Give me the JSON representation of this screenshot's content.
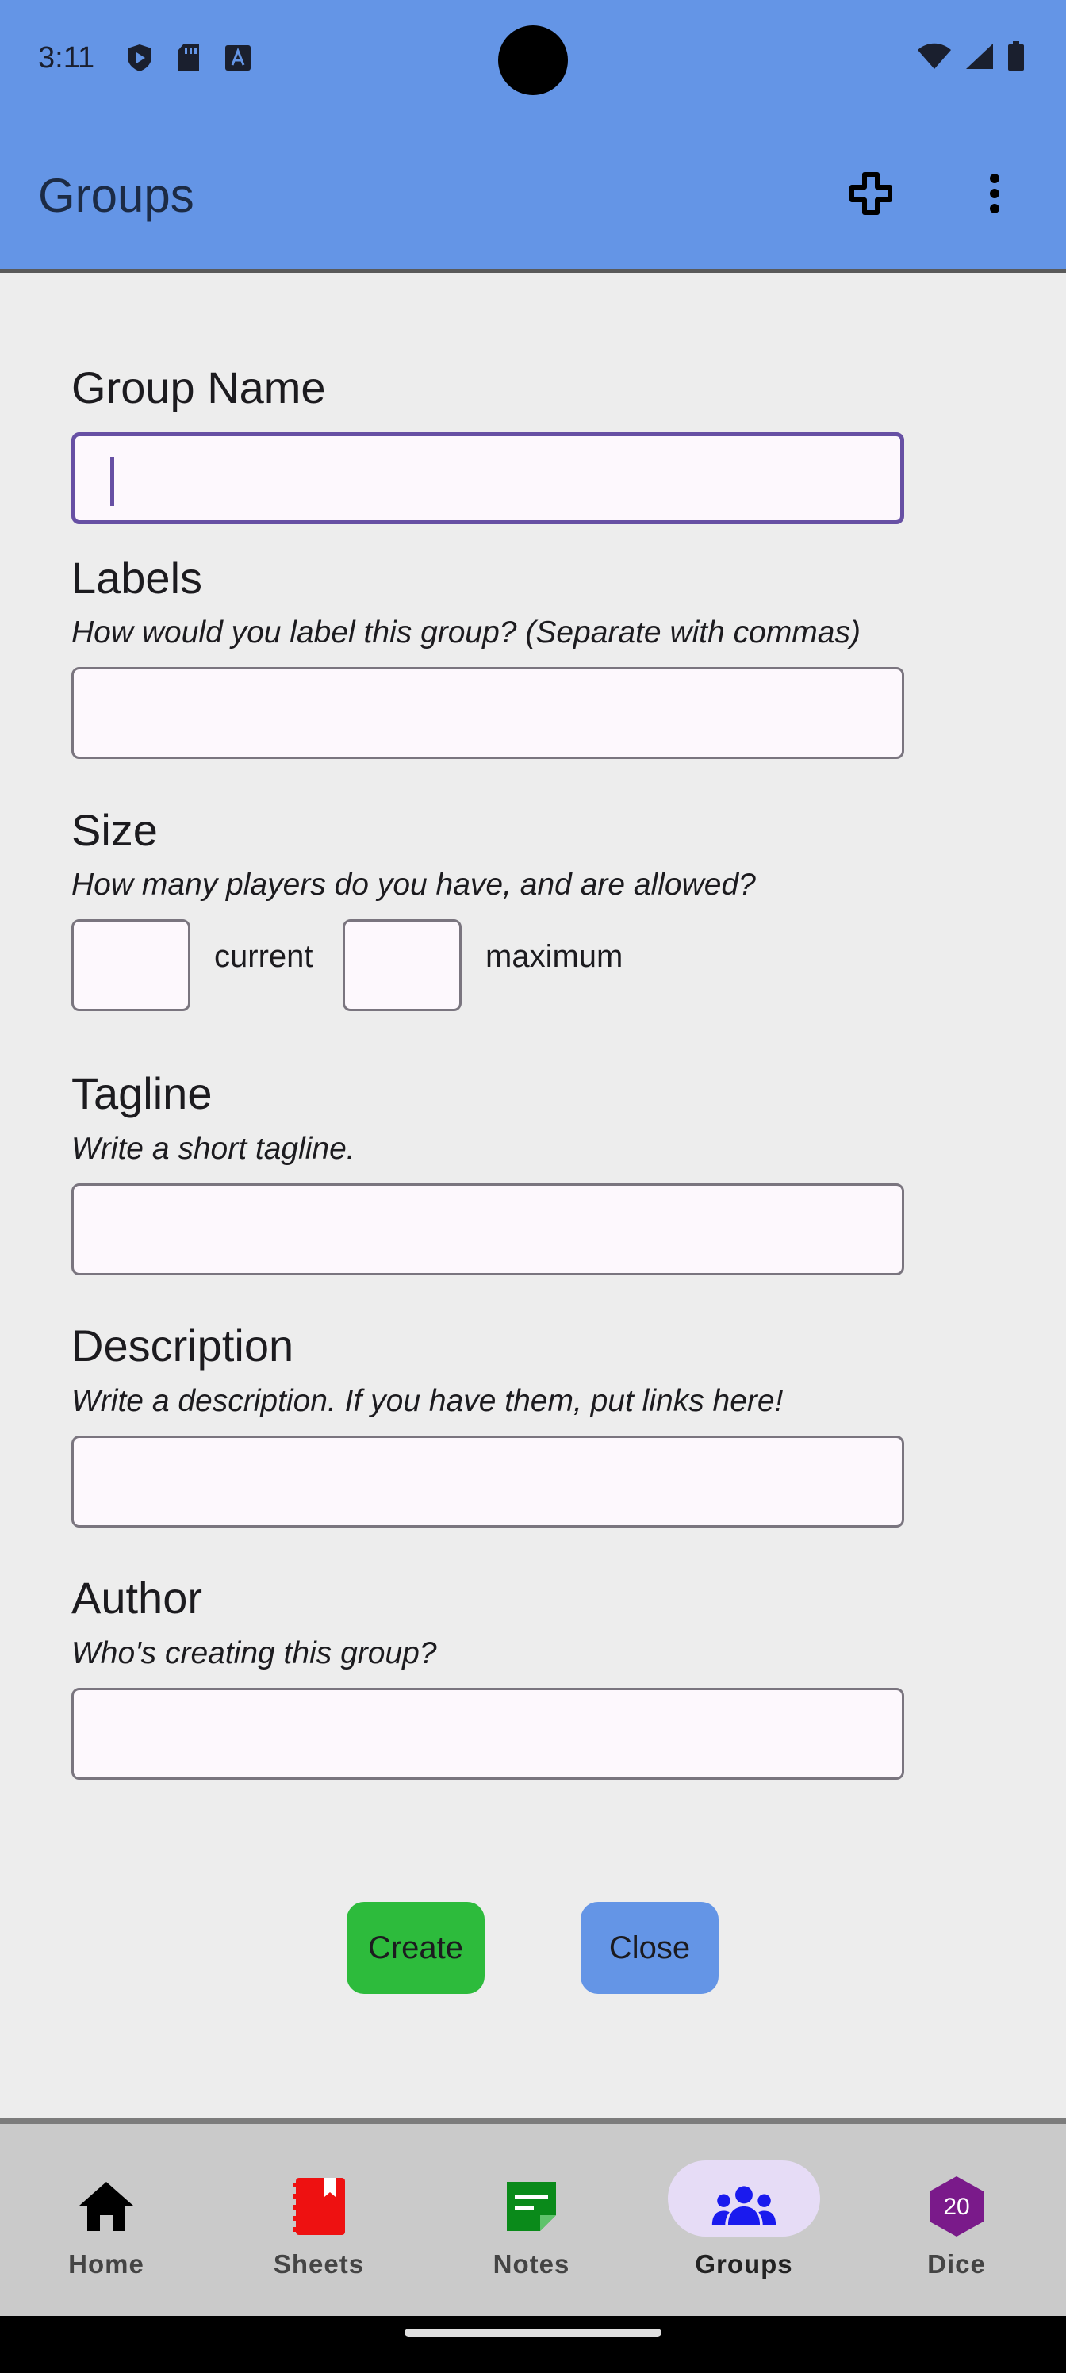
{
  "status_bar": {
    "time": "3:11",
    "icons_left": [
      "shield-play-icon",
      "sd-card-icon",
      "font-a-icon"
    ],
    "icons_right": [
      "wifi-icon",
      "cell-signal-icon",
      "battery-icon"
    ]
  },
  "appbar": {
    "title": "Groups",
    "actions": [
      "add-icon",
      "more-vert-icon"
    ],
    "color": "#6495e6"
  },
  "form": {
    "group_name": {
      "label": "Group Name",
      "value": ""
    },
    "labels": {
      "label": "Labels",
      "help": "How would you label this group? (Separate with commas)",
      "value": ""
    },
    "size": {
      "label": "Size",
      "help": "How many players do you have, and are allowed?",
      "current_label": "current",
      "maximum_label": "maximum",
      "current_value": "",
      "maximum_value": ""
    },
    "tagline": {
      "label": "Tagline",
      "help": "Write a short tagline.",
      "value": ""
    },
    "description": {
      "label": "Description",
      "help": "Write a description. If you have them, put links here!",
      "value": ""
    },
    "author": {
      "label": "Author",
      "help": "Who's creating this group?",
      "value": ""
    }
  },
  "buttons": {
    "create": "Create",
    "close": "Close",
    "create_color": "#2dbb3c",
    "close_color": "#6495e6"
  },
  "bottom_nav": {
    "items": [
      {
        "label": "Home",
        "icon": "home-icon",
        "color": "#000000"
      },
      {
        "label": "Sheets",
        "icon": "book-icon",
        "color": "#ee1111"
      },
      {
        "label": "Notes",
        "icon": "note-icon",
        "color": "#0a8a1a"
      },
      {
        "label": "Groups",
        "icon": "groups-icon",
        "color": "#1a1aee",
        "selected": true
      },
      {
        "label": "Dice",
        "icon": "d20-icon",
        "color": "#7a1a8a",
        "badge": "20"
      }
    ]
  }
}
